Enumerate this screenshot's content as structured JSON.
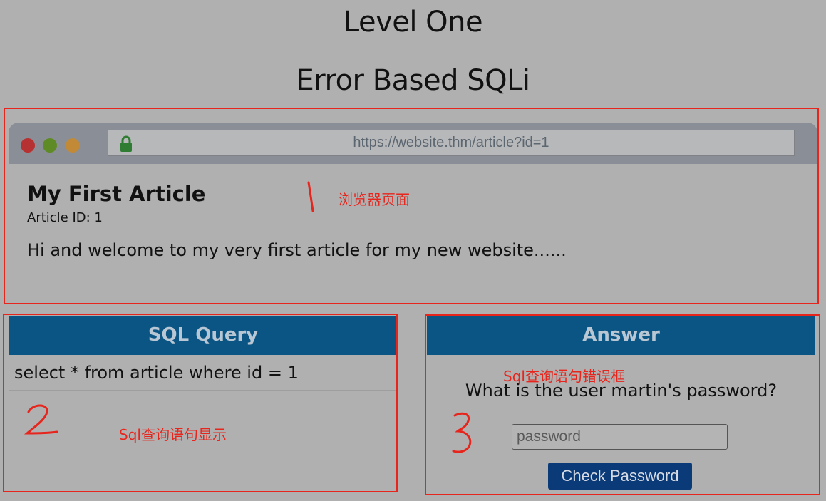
{
  "page": {
    "title_line1": "Level One",
    "title_line2": "Error Based SQLi"
  },
  "browser": {
    "url": "https://website.thm/article?id=1",
    "article_title": "My First Article",
    "article_id": "Article ID: 1",
    "article_body": "Hi and welcome to my very first article for my new website......"
  },
  "sql_panel": {
    "header": "SQL Query",
    "query": "select * from article where id = 1"
  },
  "answer_panel": {
    "header": "Answer",
    "question": "What is the user martin's password?",
    "password_placeholder": "password",
    "password_value": "",
    "button_label": "Check Password"
  },
  "annotations": {
    "label1": "浏览器页面",
    "label2": "Sql查询语句显示",
    "label3": "Sql查询语句错误框",
    "marker1": "1",
    "marker2": "2",
    "marker3": "3"
  },
  "colors": {
    "background": "#b0b0b0",
    "panel_header": "#0b5585",
    "button": "#0b3a78",
    "annotation_red": "#e8251c"
  },
  "icons": {
    "browser_dots": [
      "red-dot",
      "green-dot",
      "yellow-dot"
    ],
    "url_icon": "lock-icon"
  }
}
